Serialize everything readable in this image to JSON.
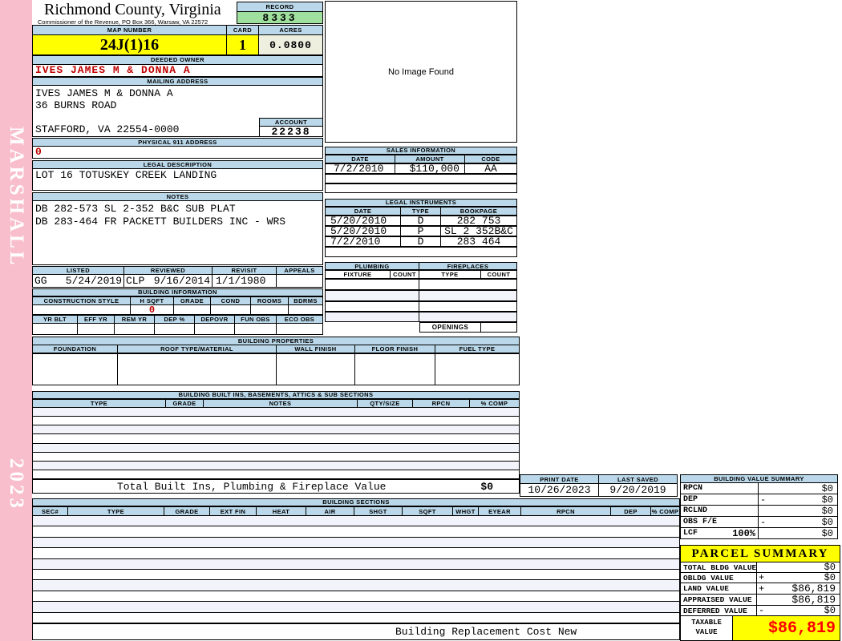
{
  "sidebar": {
    "vendor_label": "MARSHALL",
    "year_label": "2023"
  },
  "header": {
    "county_title": "Richmond County, Virginia",
    "commissioner_line": "Commissioner of the Revenue, PO Box 366, Warsaw, VA 22572",
    "record_label": "RECORD",
    "record_value": "8333",
    "map_number_label": "MAP NUMBER",
    "map_number_value": "24J(1)16",
    "card_label": "CARD",
    "card_value": "1",
    "acres_label": "ACRES",
    "acres_value": "0.0800"
  },
  "image_panel": {
    "placeholder_text": "No Image Found"
  },
  "owner": {
    "deeded_owner_label": "DEEDED OWNER",
    "deeded_owner_value": "IVES JAMES M & DONNA A",
    "mailing_address_label": "MAILING ADDRESS",
    "mailing_lines": [
      "IVES JAMES M & DONNA A",
      "36 BURNS ROAD",
      "",
      "STAFFORD, VA 22554-0000"
    ],
    "account_label": "ACCOUNT",
    "account_value": "22238",
    "physical_address_label": "PHYSICAL 911 ADDRESS",
    "physical_address_value": "0"
  },
  "legal_description": {
    "label": "LEGAL DESCRIPTION",
    "value": "LOT 16 TOTUSKEY CREEK LANDING"
  },
  "notes": {
    "label": "NOTES",
    "lines": [
      "DB 282-573 SL 2-352 B&C SUB PLAT",
      "DB 283-464 FR PACKETT BUILDERS INC - WRS"
    ]
  },
  "review": {
    "headers": [
      "LISTED",
      "REVIEWED",
      "REVISIT",
      "APPEALS"
    ],
    "listed_code": "GG",
    "listed_date": "5/24/2019",
    "reviewed_code": "CLP",
    "reviewed_date": "9/16/2014",
    "revisit_date": "1/1/1980",
    "appeals_value": ""
  },
  "building_information": {
    "title": "BUILDING INFORMATION",
    "row1_headers": [
      "CONSTRUCTION STYLE",
      "H SQFT",
      "GRADE",
      "COND",
      "ROOMS",
      "BDRMS"
    ],
    "row1_values": [
      "",
      "0",
      "",
      "",
      "",
      ""
    ],
    "row2_headers": [
      "YR BLT",
      "EFF YR",
      "REM YR",
      "DEP %",
      "DEPOVR",
      "FUN OBS",
      "ECO OBS"
    ],
    "row2_values": [
      "",
      "",
      "",
      "",
      "",
      "",
      ""
    ]
  },
  "building_properties": {
    "title": "BUILDING PROPERTIES",
    "headers": [
      "FOUNDATION",
      "ROOF TYPE/MATERIAL",
      "WALL FINISH",
      "FLOOR FINISH",
      "FUEL TYPE"
    ]
  },
  "sales": {
    "title": "SALES INFORMATION",
    "headers": [
      "DATE",
      "AMOUNT",
      "CODE"
    ],
    "rows": [
      {
        "date": "7/2/2010",
        "amount": "$110,000",
        "code": "AA"
      }
    ]
  },
  "instruments": {
    "title": "LEGAL INSTRUMENTS",
    "headers": [
      "DATE",
      "TYPE",
      "BOOKPAGE"
    ],
    "rows": [
      {
        "date": "5/20/2010",
        "type": "D",
        "bookpage": "282 753"
      },
      {
        "date": "5/20/2010",
        "type": "P",
        "bookpage": "SL 2 352B&C"
      },
      {
        "date": "7/2/2010",
        "type": "D",
        "bookpage": "283 464"
      }
    ]
  },
  "plumbing": {
    "title": "PLUMBING",
    "headers": [
      "FIXTURE",
      "COUNT"
    ]
  },
  "fireplaces": {
    "title": "FIREPLACES",
    "headers": [
      "TYPE",
      "COUNT"
    ],
    "openings_label": "OPENINGS"
  },
  "built_ins": {
    "title": "BUILDING BUILT INS, BASEMENTS, ATTICS & SUB SECTIONS",
    "headers": [
      "TYPE",
      "GRADE",
      "NOTES",
      "QTY/SIZE",
      "RPCN",
      "% COMP"
    ],
    "total_label": "Total Built Ins, Plumbing & Fireplace Value",
    "total_value": "$0"
  },
  "print_info": {
    "print_date_label": "PRINT DATE",
    "print_date_value": "10/26/2023",
    "last_saved_label": "LAST SAVED",
    "last_saved_value": "9/20/2019"
  },
  "building_value_summary": {
    "title": "BUILDING VALUE SUMMARY",
    "rows": [
      {
        "label": "RPCN",
        "suffix": "",
        "op": "",
        "value": "$0"
      },
      {
        "label": "DEP",
        "suffix": "",
        "op": "-",
        "value": "$0"
      },
      {
        "label": "RCLND",
        "suffix": "",
        "op": "",
        "value": "$0"
      },
      {
        "label": "OBS F/E",
        "suffix": "",
        "op": "-",
        "value": "$0"
      },
      {
        "label": "LCF",
        "suffix": "100%",
        "op": "",
        "value": "$0"
      }
    ]
  },
  "building_sections": {
    "title": "BUILDING SECTIONS",
    "headers": [
      "SEC#",
      "TYPE",
      "GRADE",
      "EXT FIN",
      "HEAT",
      "AIR",
      "SHGT",
      "SQFT",
      "WHGT",
      "EYEAR",
      "RPCN",
      "DEP",
      "% COMP"
    ],
    "footer_label": "Building Replacement Cost New"
  },
  "parcel_summary": {
    "title": "PARCEL SUMMARY",
    "rows": [
      {
        "label": "TOTAL BLDG VALUE",
        "op": "",
        "value": "$0"
      },
      {
        "label": "OBLDG VALUE",
        "op": "+",
        "value": "$0"
      },
      {
        "label": "LAND VALUE",
        "op": "+",
        "value": "$86,819"
      },
      {
        "label": "APPRAISED VALUE",
        "op": "",
        "value": "$86,819"
      },
      {
        "label": "DEFERRED VALUE",
        "op": "-",
        "value": "$0"
      }
    ],
    "taxable_label": "TAXABLE VALUE",
    "taxable_value": "$86,819"
  },
  "colors": {
    "header_band": "#BAD8E9",
    "highlight_yellow": "#FFFF00",
    "record_green": "#9FE09F",
    "acres_cream": "#EFEFE0",
    "sidebar_pink": "#F8BECC",
    "alert_red": "#C00000",
    "taxable_red": "#FF0000"
  }
}
